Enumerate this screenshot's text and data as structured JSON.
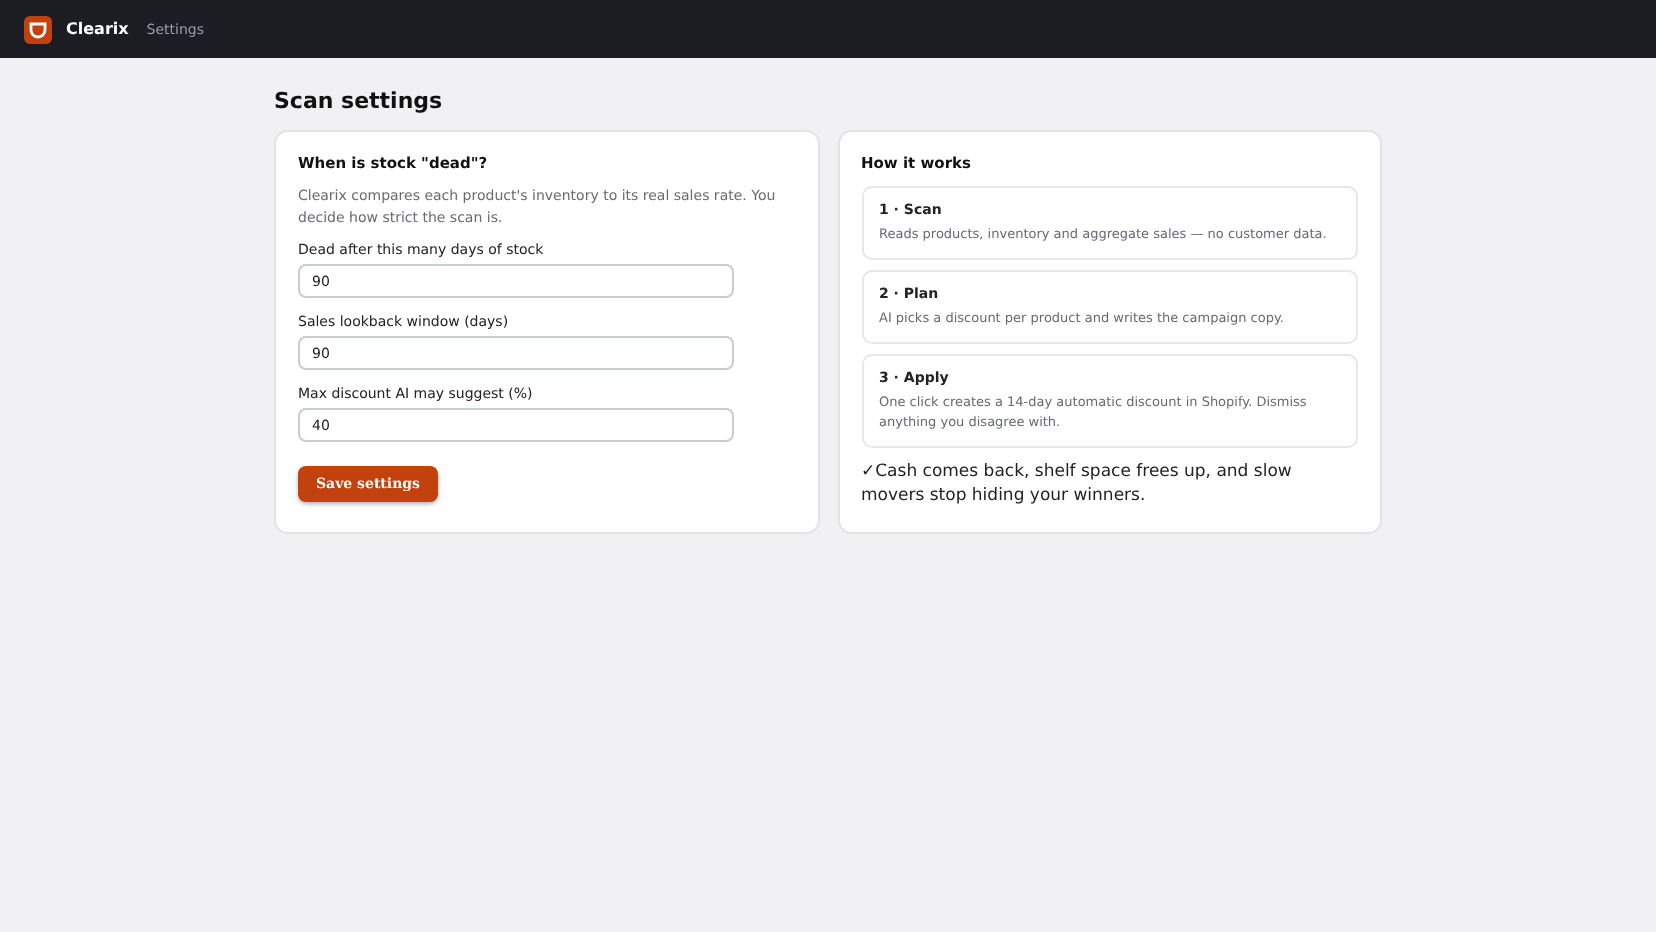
{
  "topbar": {
    "brand": "Clearix",
    "nav": "Settings"
  },
  "title": "Scan settings",
  "settings_card": {
    "heading": "When is stock \"dead\"?",
    "description": "Clearix compares each product's inventory to its real sales rate. You decide how strict the scan is.",
    "fields": [
      {
        "label": "Dead after this many days of stock",
        "value": "90"
      },
      {
        "label": "Sales lookback window (days)",
        "value": "90"
      },
      {
        "label": "Max discount AI may suggest (%)",
        "value": "40"
      }
    ],
    "save_button": "Save settings"
  },
  "how_card": {
    "heading": "How it works",
    "steps": [
      {
        "title": "1 · Scan",
        "text": "Reads products, inventory and aggregate sales — no customer data."
      },
      {
        "title": "2 · Plan",
        "text": "AI picks a discount per product and writes the campaign copy."
      },
      {
        "title": "3 · Apply",
        "text": "One click creates a 14-day automatic discount in Shopify. Dismiss anything you disagree with."
      }
    ],
    "footer": "✓Cash comes back, shelf space frees up, and slow movers stop hiding your winners."
  }
}
